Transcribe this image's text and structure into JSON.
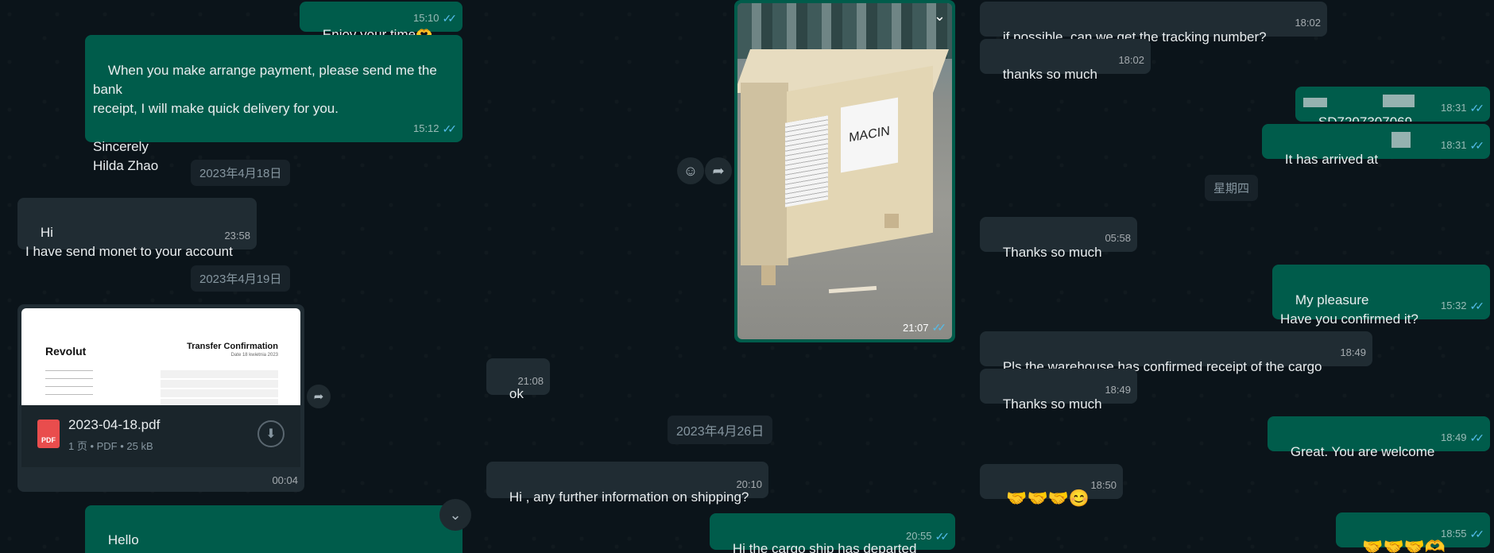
{
  "panel1": {
    "msg_enjoy": {
      "text": "Enjoy your time🫶",
      "time": "15:10"
    },
    "msg_payment": {
      "text": "When you make arrange payment, please send me the bank\nreceipt, I will make quick delivery for you.\n\nSincerely\nHilda Zhao",
      "time": "15:12"
    },
    "date1": "2023年4月18日",
    "msg_hi": {
      "text": "Hi\nI have send monet to your account",
      "time": "23:58"
    },
    "date2": "2023年4月19日",
    "doc": {
      "brand": "Revolut",
      "title": "Transfer Confirmation",
      "subtitle": "Date 18 kwietnia 2023",
      "filename": "2023-04-18.pdf",
      "details": "1 页 • PDF • 25 kB",
      "time": "00:04",
      "pdf_badge": "PDF"
    },
    "msg_hello": {
      "text": "Hello\nThank you."
    }
  },
  "panel2": {
    "photo_text": "MACIN",
    "photo_time": "21:07",
    "msg_ok": {
      "text": "ok",
      "time": "21:08"
    },
    "date3": "2023年4月26日",
    "msg_shipping": {
      "text": "Hi , any further information on shipping?",
      "time": "20:10"
    },
    "msg_departed": {
      "text": "Hi the cargo ship has departed",
      "time": "20:55"
    }
  },
  "panel3": {
    "msg_tracking": {
      "text": "if possible, can we get the tracking number?",
      "time": "18:02"
    },
    "msg_thanks1": {
      "text": "thanks so much",
      "time": "18:02"
    },
    "msg_code": {
      "text": "SD7207307069",
      "time": "18:31"
    },
    "msg_arrived": {
      "text": "It has arrived at",
      "time": "18:31"
    },
    "date4": "星期四",
    "msg_thanks2": {
      "text": "Thanks so much",
      "time": "05:58"
    },
    "msg_pleasure": {
      "text": "My pleasure\nHave you confirmed it?",
      "time": "15:32"
    },
    "msg_warehouse": {
      "text": "Pls the warehouse has confirmed receipt of the cargo",
      "time": "18:49"
    },
    "msg_thanks3": {
      "text": "Thanks so much",
      "time": "18:49"
    },
    "msg_welcome": {
      "text": "Great. You are welcome",
      "time": "18:49"
    },
    "msg_emoji_in": {
      "text": "🤝🤝🤝😊",
      "time": "18:50"
    },
    "msg_emoji_out": {
      "text": "🤝🤝🤝🫶",
      "time": "18:55"
    }
  },
  "colors": {
    "outgoing": "#005c4b",
    "incoming": "#202c33",
    "background": "#0b141a",
    "read_ticks": "#53bdeb"
  },
  "icons": [
    "double-check-icon",
    "forward-icon",
    "emoji-icon",
    "download-icon",
    "chevron-down-icon",
    "pdf-icon"
  ]
}
